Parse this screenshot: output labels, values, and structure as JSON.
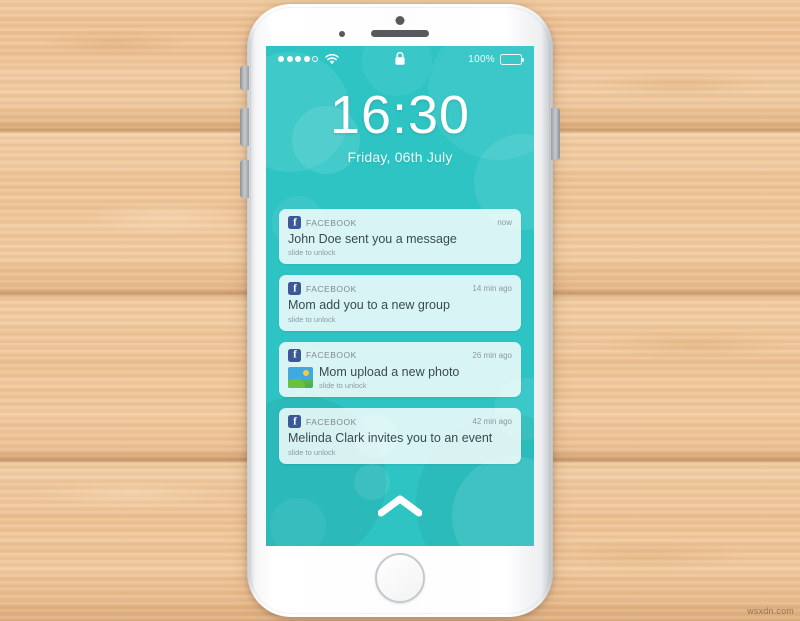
{
  "scene": {
    "background_name": "wood-planks",
    "wood_color": "#eec295",
    "watermark": "wsxdn.com"
  },
  "device": {
    "name": "white-smartphone",
    "body_color": "#ffffff",
    "buttons": {
      "silent_switch": "Silent switch",
      "volume_up": "Volume up",
      "volume_down": "Volume down",
      "power": "Power",
      "home": "Home"
    },
    "hardware": {
      "earpiece": "earpiece-speaker",
      "front_camera": "front-camera",
      "proximity_sensor": "proximity-sensor"
    }
  },
  "screen": {
    "background_color": "#2ec4c4",
    "status_bar": {
      "signal_dots_total": 5,
      "signal_dots_filled": 4,
      "wifi": "wifi-icon",
      "lock": "lock-icon",
      "battery_percent": "100%",
      "battery_level": 100
    },
    "clock": {
      "time": "16:30",
      "date": "Friday, 06th July"
    },
    "notifications": [
      {
        "app": "FACEBOOK",
        "time": "now",
        "message": "John Doe sent you a message",
        "hint": "slide to unlock",
        "has_thumbnail": false
      },
      {
        "app": "FACEBOOK",
        "time": "14 min ago",
        "message": "Mom add you to a new group",
        "hint": "slide to unlock",
        "has_thumbnail": false
      },
      {
        "app": "FACEBOOK",
        "time": "26 min ago",
        "message": "Mom upload a new photo",
        "hint": "slide to unlock",
        "has_thumbnail": true
      },
      {
        "app": "FACEBOOK",
        "time": "42 min ago",
        "message": "Melinda Clark invites you to an event",
        "hint": "slide to unlock",
        "has_thumbnail": false
      }
    ],
    "unlock_arrow": "chevron-up-icon",
    "accent_colors": {
      "teal": "#2ec4c4",
      "facebook_blue": "#3b5998",
      "card_white": "#ffffff"
    }
  }
}
